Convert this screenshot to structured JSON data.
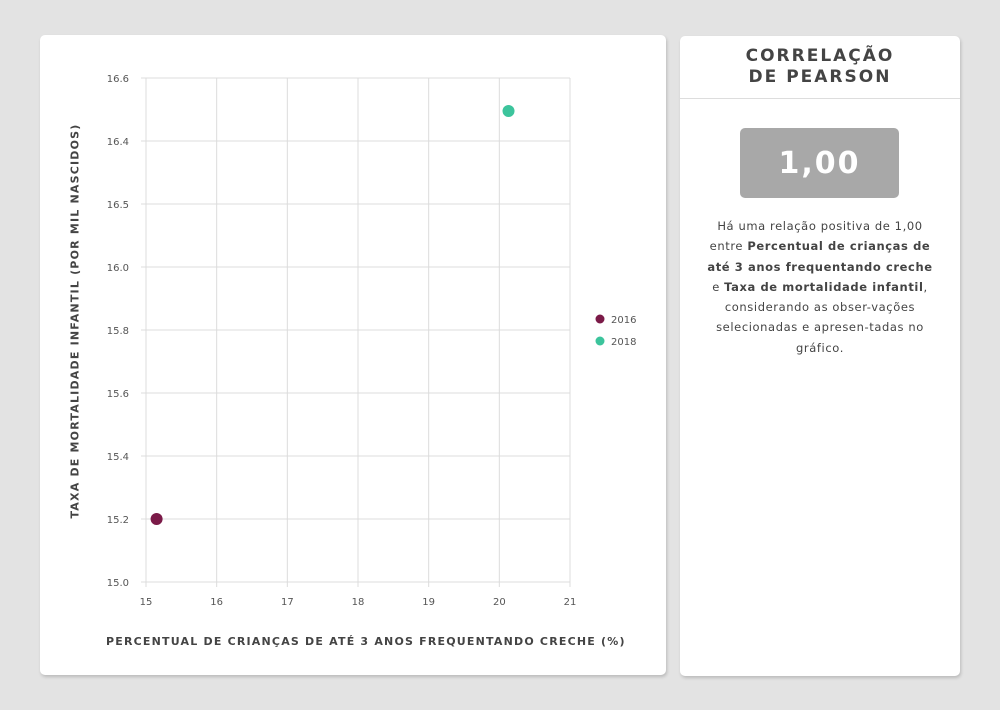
{
  "chart_data": {
    "type": "scatter",
    "xlabel": "PERCENTUAL DE CRIANÇAS DE ATÉ 3 ANOS FREQUENTANDO CRECHE (%)",
    "ylabel": "TAXA DE MORTALIDADE INFANTIL (POR MIL NASCIDOS)",
    "x_ticks": [
      "15",
      "16",
      "17",
      "18",
      "19",
      "20",
      "21"
    ],
    "y_ticks": [
      "16.6",
      "16.4",
      "16.5",
      "16.0",
      "15.8",
      "15.6",
      "15.4",
      "15.2",
      "15.0"
    ],
    "xlim": [
      15,
      21
    ],
    "ylim": [
      15.0,
      16.6
    ],
    "grid": true,
    "legend_position": "right",
    "series": [
      {
        "name": "2016",
        "color": "#7b1a48",
        "points": [
          {
            "x": 15.15,
            "y": 15.2
          }
        ]
      },
      {
        "name": "2018",
        "color": "#3cc49c",
        "points": [
          {
            "x": 20.13,
            "y": 16.5
          }
        ]
      }
    ]
  },
  "stat_panel": {
    "title_line1": "CORRELAÇÃO",
    "title_line2": "DE PEARSON",
    "value": "1,00",
    "desc": {
      "t1": "Há uma relação positiva de 1,00 entre ",
      "var1": "Percentual de crianças de até 3 anos frequentando creche",
      "t2": " e ",
      "var2": "Taxa de mortalidade infantil",
      "t3": ", considerando as obser-vações selecionadas e apresen-tadas no gráfico."
    }
  }
}
